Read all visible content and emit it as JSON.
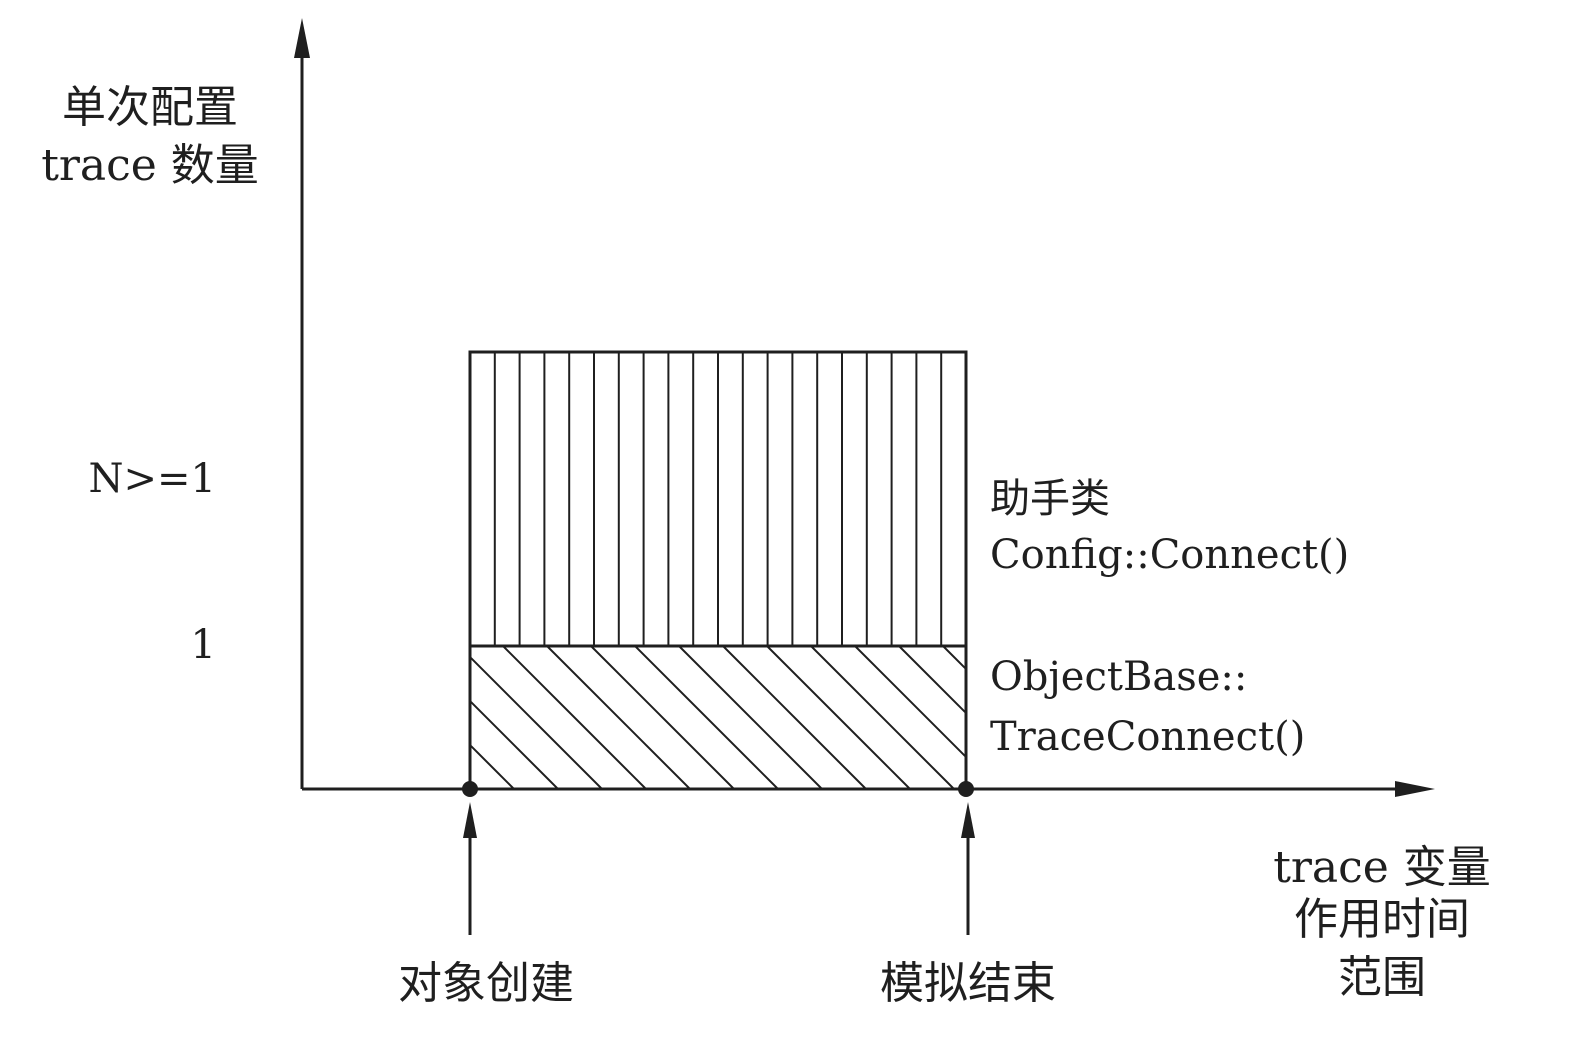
{
  "y_axis": {
    "label_lines": [
      "单次配置",
      "trace 数量"
    ],
    "ticks": {
      "upper": "N>=1",
      "lower": "1"
    }
  },
  "x_axis": {
    "label_lines": [
      "trace 变量",
      "作用时间",
      "范围"
    ]
  },
  "blocks": {
    "upper": {
      "label_lines": [
        "助手类",
        "Config::Connect()"
      ],
      "pattern": "vertical-lines"
    },
    "lower": {
      "label_lines": [
        "ObjectBase::",
        "TraceConnect()"
      ],
      "pattern": "diagonal-lines"
    }
  },
  "markers": {
    "start": "对象创建",
    "end": "模拟结束"
  },
  "colors": {
    "ink": "#1f1f1f",
    "paper": "#ffffff"
  }
}
